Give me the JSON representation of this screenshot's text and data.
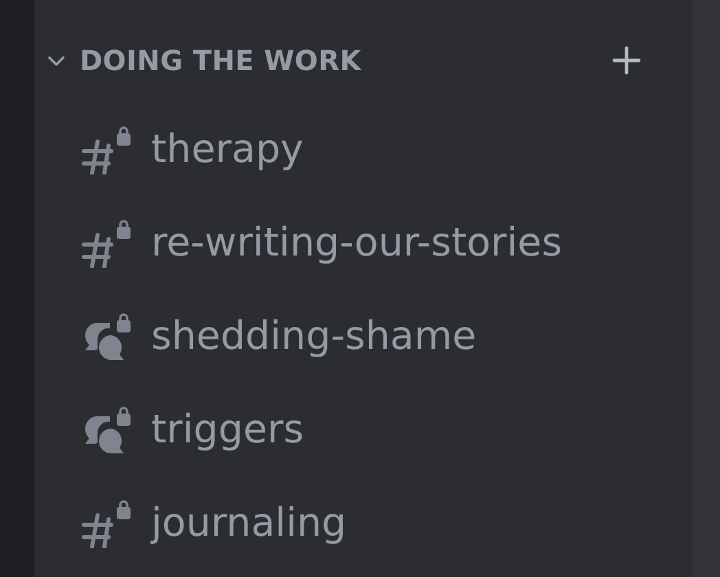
{
  "category": {
    "title": "DOING THE WORK",
    "expanded": true
  },
  "channels": [
    {
      "name": "therapy",
      "kind": "text"
    },
    {
      "name": "re-writing-our-stories",
      "kind": "text"
    },
    {
      "name": "shedding-shame",
      "kind": "forum"
    },
    {
      "name": "triggers",
      "kind": "forum"
    },
    {
      "name": "journaling",
      "kind": "text"
    }
  ]
}
